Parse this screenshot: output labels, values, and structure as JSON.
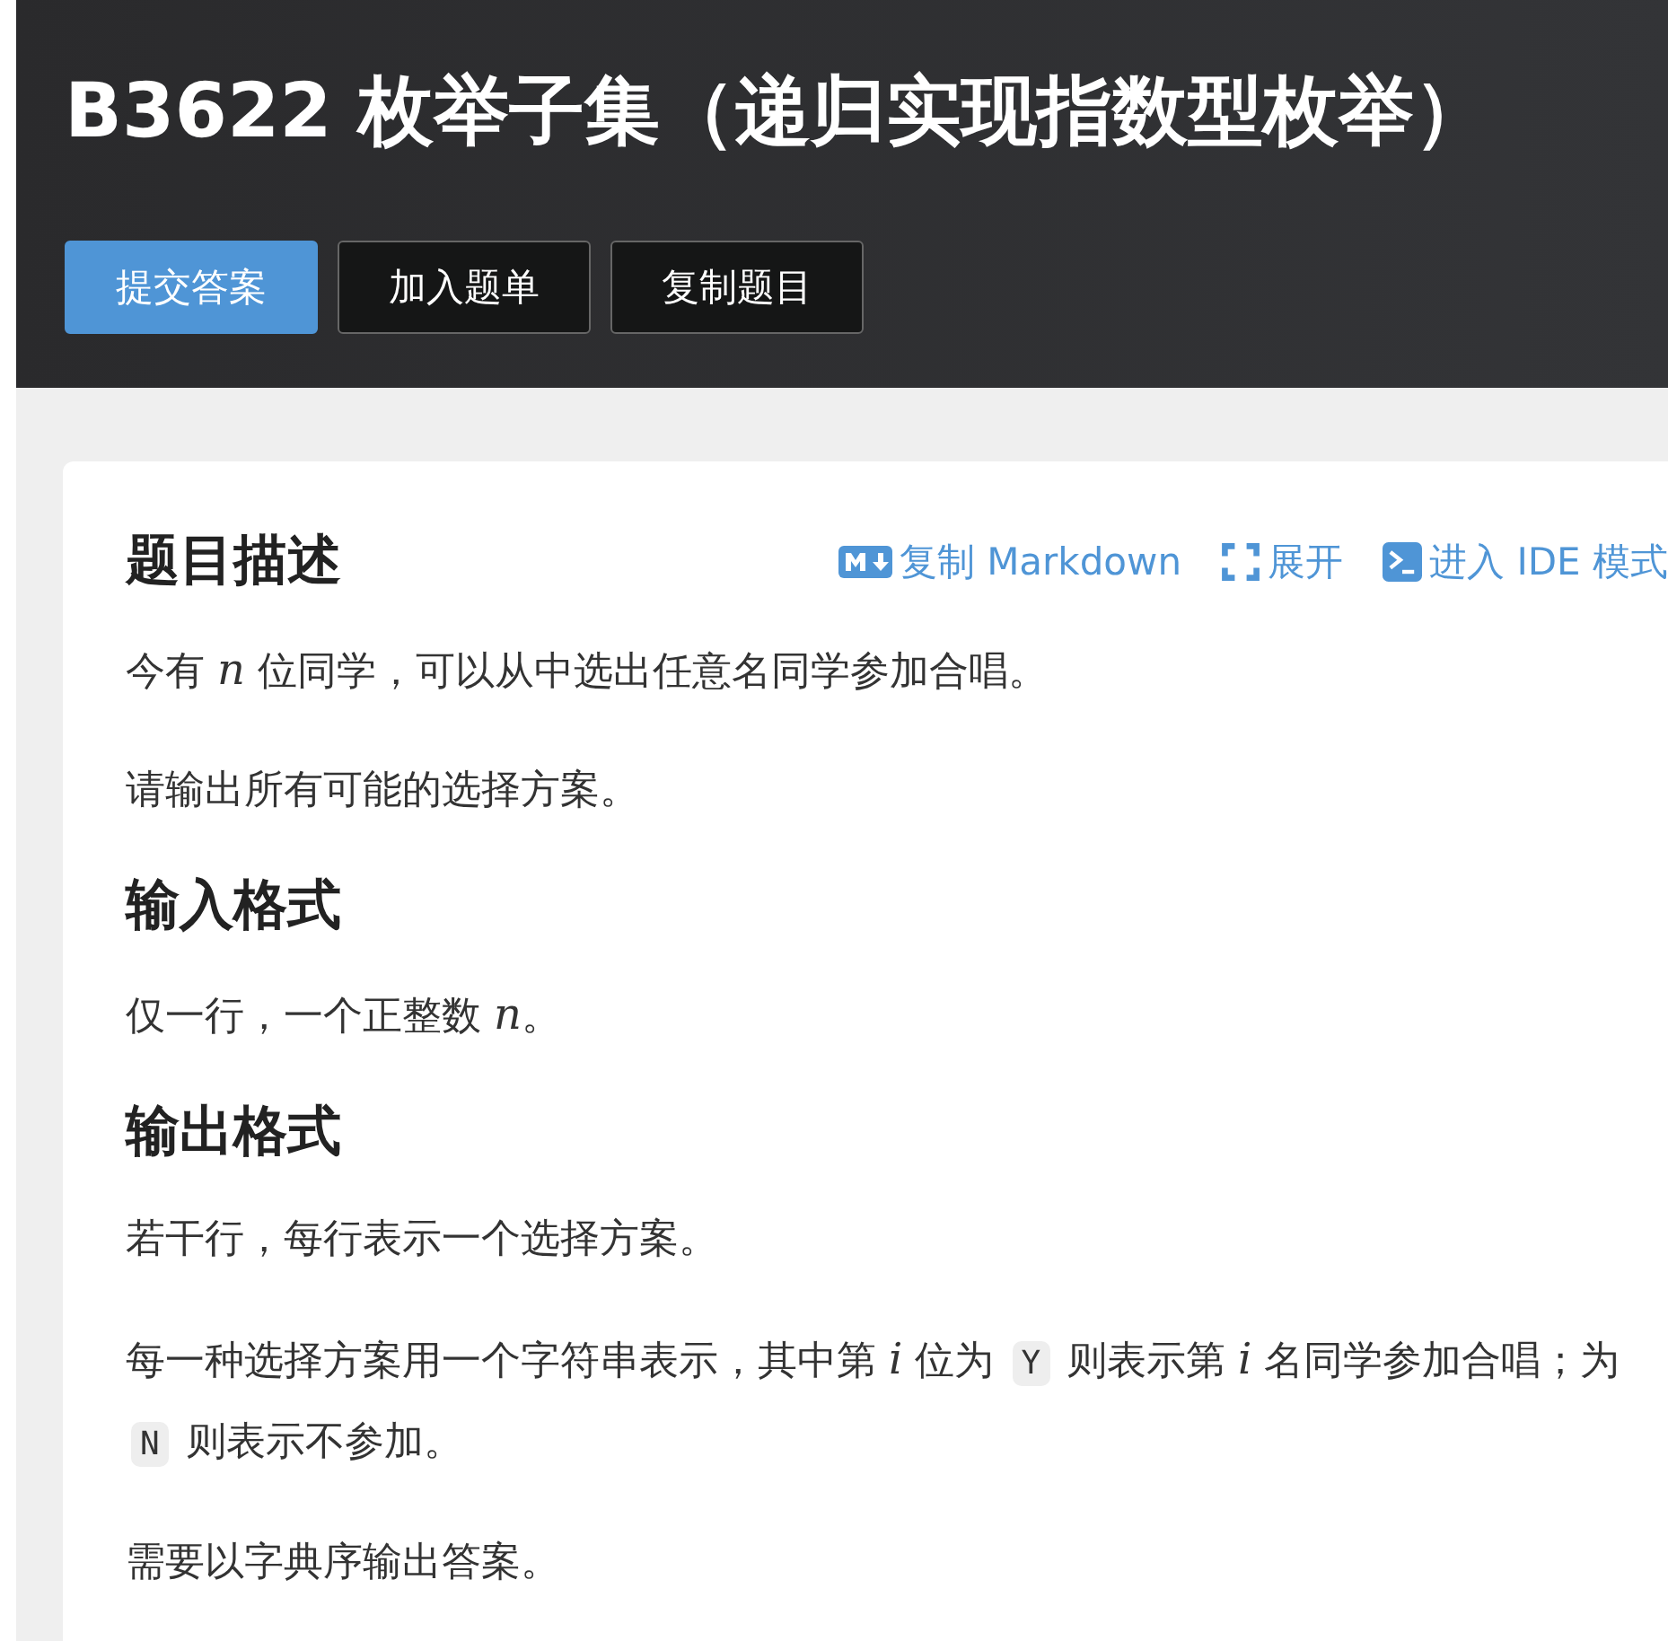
{
  "title": "B3622 枚举子集（递归实现指数型枚举）",
  "buttons": [
    {
      "label": "提交答案",
      "kind": "primary"
    },
    {
      "label": "加入题单",
      "kind": "dark"
    },
    {
      "label": "复制题目",
      "kind": "dark"
    }
  ],
  "actions": [
    {
      "label": "复制 Markdown",
      "kind": "markdown"
    },
    {
      "label": "展开",
      "kind": "expand"
    },
    {
      "label": "进入 IDE 模式",
      "kind": "ide"
    }
  ],
  "sections": [
    {
      "heading": "题目描述",
      "paragraphs": [
        [
          {
            "kind": "text",
            "text": "今有 "
          },
          {
            "kind": "math",
            "text": "n"
          },
          {
            "kind": "text",
            "text": " 位同学，可以从中选出任意名同学参加合唱。"
          }
        ],
        [
          {
            "kind": "text",
            "text": "请输出所有可能的选择方案。"
          }
        ]
      ]
    },
    {
      "heading": "输入格式",
      "paragraphs": [
        [
          {
            "kind": "text",
            "text": "仅一行，一个正整数 "
          },
          {
            "kind": "math",
            "text": "n"
          },
          {
            "kind": "text",
            "text": "。"
          }
        ]
      ]
    },
    {
      "heading": "输出格式",
      "paragraphs": [
        [
          {
            "kind": "text",
            "text": "若干行，每行表示一个选择方案。"
          }
        ],
        [
          {
            "kind": "text",
            "text": "每一种选择方案用一个字符串表示，其中第 "
          },
          {
            "kind": "math",
            "text": "i"
          },
          {
            "kind": "text",
            "text": " 位为 "
          },
          {
            "kind": "code",
            "text": "Y"
          },
          {
            "kind": "text",
            "text": " 则表示第 "
          },
          {
            "kind": "math",
            "text": "i"
          },
          {
            "kind": "text",
            "text": " 名同学参加合唱；为 "
          },
          {
            "kind": "code",
            "text": "N"
          },
          {
            "kind": "text",
            "text": " 则表示不参加。"
          }
        ],
        [
          {
            "kind": "text",
            "text": "需要以字典序输出答案。"
          }
        ]
      ]
    }
  ]
}
